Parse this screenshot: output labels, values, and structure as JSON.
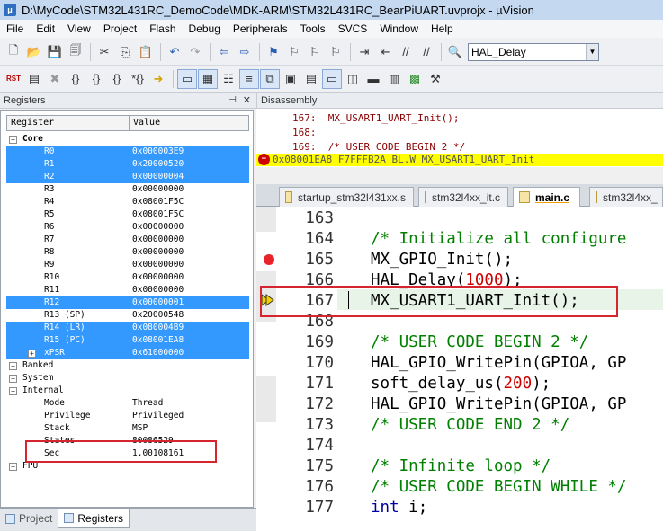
{
  "window": {
    "title": "D:\\MyCode\\STM32L431RC_DemoCode\\MDK-ARM\\STM32L431RC_BearPiUART.uvprojx - µVision"
  },
  "menu": [
    "File",
    "Edit",
    "View",
    "Project",
    "Flash",
    "Debug",
    "Peripherals",
    "Tools",
    "SVCS",
    "Window",
    "Help"
  ],
  "toolbar": {
    "function_combo": "HAL_Delay",
    "rst_label": "RST"
  },
  "registers_panel": {
    "title": "Registers",
    "col_register": "Register",
    "col_value": "Value",
    "core_label": "Core",
    "rows": [
      {
        "name": "R0",
        "value": "0x000003E9",
        "selected": true
      },
      {
        "name": "R1",
        "value": "0x20000520",
        "selected": true
      },
      {
        "name": "R2",
        "value": "0x00000004",
        "selected": true
      },
      {
        "name": "R3",
        "value": "0x00000000",
        "selected": false
      },
      {
        "name": "R4",
        "value": "0x08001F5C",
        "selected": false
      },
      {
        "name": "R5",
        "value": "0x08001F5C",
        "selected": false
      },
      {
        "name": "R6",
        "value": "0x00000000",
        "selected": false
      },
      {
        "name": "R7",
        "value": "0x00000000",
        "selected": false
      },
      {
        "name": "R8",
        "value": "0x00000000",
        "selected": false
      },
      {
        "name": "R9",
        "value": "0x00000000",
        "selected": false
      },
      {
        "name": "R10",
        "value": "0x00000000",
        "selected": false
      },
      {
        "name": "R11",
        "value": "0x00000000",
        "selected": false
      },
      {
        "name": "R12",
        "value": "0x00000001",
        "selected": true
      },
      {
        "name": "R13 (SP)",
        "value": "0x20000548",
        "selected": false
      },
      {
        "name": "R14 (LR)",
        "value": "0x080004B9",
        "selected": true
      },
      {
        "name": "R15 (PC)",
        "value": "0x08001EA8",
        "selected": true
      },
      {
        "name": "xPSR",
        "value": "0x61000000",
        "selected": true
      }
    ],
    "groups": {
      "banked": "Banked",
      "system": "System",
      "internal": "Internal",
      "fpu": "FPU"
    },
    "internal": [
      {
        "name": "Mode",
        "value": "Thread"
      },
      {
        "name": "Privilege",
        "value": "Privileged"
      },
      {
        "name": "Stack",
        "value": "MSP"
      },
      {
        "name": "States",
        "value": "80086529"
      },
      {
        "name": "Sec",
        "value": "1.00108161"
      }
    ]
  },
  "bottom_tabs": {
    "project": "Project",
    "registers": "Registers"
  },
  "disassembly": {
    "title": "Disassembly",
    "lines": [
      {
        "num": "167:",
        "text": "MX_USART1_UART_Init();"
      },
      {
        "num": "168:",
        "text": ""
      },
      {
        "num": "169:",
        "text": "/* USER CODE BEGIN 2 */"
      }
    ],
    "current": "0x08001EA8 F7FFFB2A  BL.W          MX_USART1_UART_Init"
  },
  "file_tabs": [
    "startup_stm32l431xx.s",
    "stm32l4xx_it.c",
    "main.c",
    "stm32l4xx_"
  ],
  "editor": {
    "lines": [
      {
        "n": "163",
        "t": ""
      },
      {
        "n": "164",
        "t": "/* Initialize all configure"
      },
      {
        "n": "165",
        "t": "MX_GPIO_Init();"
      },
      {
        "n": "166",
        "a": "HAL_Delay(",
        "b": "1000",
        "c": ");"
      },
      {
        "n": "167",
        "t": "MX_USART1_UART_Init();"
      },
      {
        "n": "168",
        "t": ""
      },
      {
        "n": "169",
        "t": "/* USER CODE BEGIN 2 */"
      },
      {
        "n": "170",
        "t": "HAL_GPIO_WritePin(GPIOA, GP"
      },
      {
        "n": "171",
        "a": "soft_delay_us(",
        "b": "200",
        "c": ");"
      },
      {
        "n": "172",
        "t": "HAL_GPIO_WritePin(GPIOA, GP"
      },
      {
        "n": "173",
        "t": "/* USER CODE END 2 */"
      },
      {
        "n": "174",
        "t": ""
      },
      {
        "n": "175",
        "t": "/* Infinite loop */"
      },
      {
        "n": "176",
        "t": "/* USER CODE BEGIN WHILE */"
      },
      {
        "n": "177",
        "a": "int",
        "b": "i;"
      }
    ]
  }
}
